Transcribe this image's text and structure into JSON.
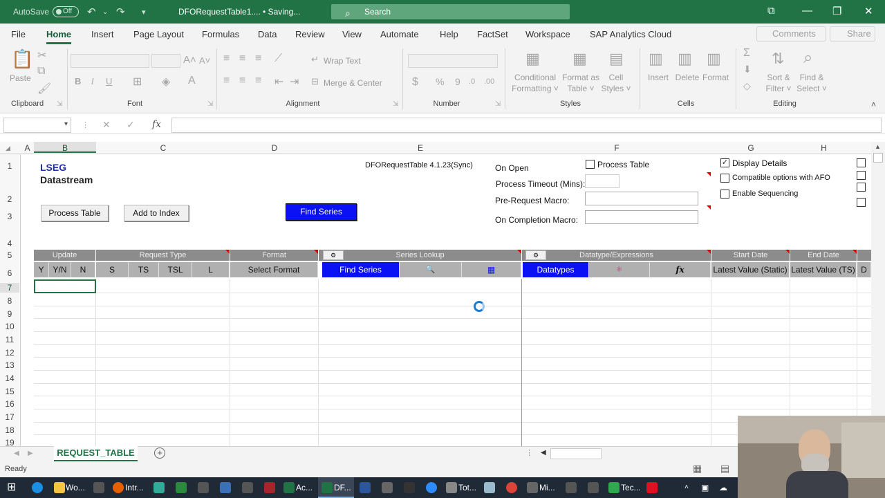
{
  "titlebar": {
    "autosave": "AutoSave",
    "toggle": "Off",
    "filename": "DFORequestTable1....  •  Saving...",
    "search": "Search"
  },
  "menu": [
    "File",
    "Home",
    "Insert",
    "Page Layout",
    "Formulas",
    "Data",
    "Review",
    "View",
    "Automate",
    "Help",
    "FactSet",
    "Workspace",
    "SAP Analytics Cloud"
  ],
  "menu_right": {
    "comments": "Comments",
    "share": "Share"
  },
  "ribbon": {
    "clipboard": {
      "paste": "Paste",
      "group": "Clipboard"
    },
    "font": {
      "group": "Font",
      "bold": "B",
      "italic": "I",
      "underline": "U"
    },
    "alignment": {
      "wrap": "Wrap Text",
      "merge": "Merge & Center",
      "group": "Alignment"
    },
    "number": {
      "group": "Number",
      "dollar": "$",
      "percent": "%",
      "comma": "9"
    },
    "styles": {
      "cond1": "Conditional",
      "cond2": "Formatting ˅",
      "fmt1": "Format as",
      "fmt2": "Table ˅",
      "cell1": "Cell",
      "cell2": "Styles ˅",
      "group": "Styles"
    },
    "cells": {
      "insert": "Insert",
      "delete": "Delete",
      "format": "Format",
      "group": "Cells"
    },
    "editing": {
      "sort1": "Sort &",
      "sort2": "Filter ˅",
      "find1": "Find &",
      "find2": "Select ˅",
      "group": "Editing"
    }
  },
  "formula_bar": {
    "fx": "fx",
    "value": ""
  },
  "columns": [
    "A",
    "B",
    "C",
    "D",
    "E",
    "F",
    "G",
    "H"
  ],
  "rows": [
    "1",
    "2",
    "3",
    "4",
    "5",
    "6",
    "7",
    "8",
    "9",
    "10",
    "11",
    "12",
    "13",
    "14",
    "15",
    "16",
    "17",
    "18",
    "19"
  ],
  "sheet": {
    "brand1": "LSEG",
    "brand2": "Datastream",
    "version": "DFORequestTable 4.1.23(Sync)",
    "process_table_btn": "Process Table",
    "add_index_btn": "Add to Index",
    "find_series_btn": "Find Series",
    "on_open": "On Open",
    "process_table_cb": "Process Table",
    "process_timeout": "Process Timeout (Mins):",
    "pre_request": "Pre-Request Macro:",
    "on_completion": "On Completion Macro:",
    "display_details": "Display Details",
    "compatible_afo": "Compatible options with AFO",
    "enable_sequencing": "Enable Sequencing",
    "row5": {
      "update": "Update",
      "request_type": "Request Type",
      "format": "Format",
      "series_lookup": "Series Lookup",
      "datatype": "Datatype/Expressions",
      "start_date": "Start Date",
      "end_date": "End Date"
    },
    "row6": {
      "y": "Y",
      "yn": "Y/N",
      "n": "N",
      "s": "S",
      "ts": "TS",
      "tsl": "TSL",
      "l": "L",
      "select_format": "Select Format",
      "find_series": "Find Series",
      "datatypes": "Datatypes",
      "fx": "fx",
      "latest_static": "Latest Value (Static)",
      "latest_ts": "Latest Value (TS)",
      "d": "D"
    }
  },
  "sheet_tab": "REQUEST_TABLE",
  "status": "Ready",
  "taskbar": {
    "wo": "Wo...",
    "intr": "Intr...",
    "ac": "Ac...",
    "df": "DF...",
    "tot": "Tot...",
    "mi": "Mi...",
    "tec": "Tec..."
  },
  "colors": {
    "excel_green": "#217346",
    "find_blue": "#0a11f5",
    "header_gray": "#8c8c8c"
  }
}
